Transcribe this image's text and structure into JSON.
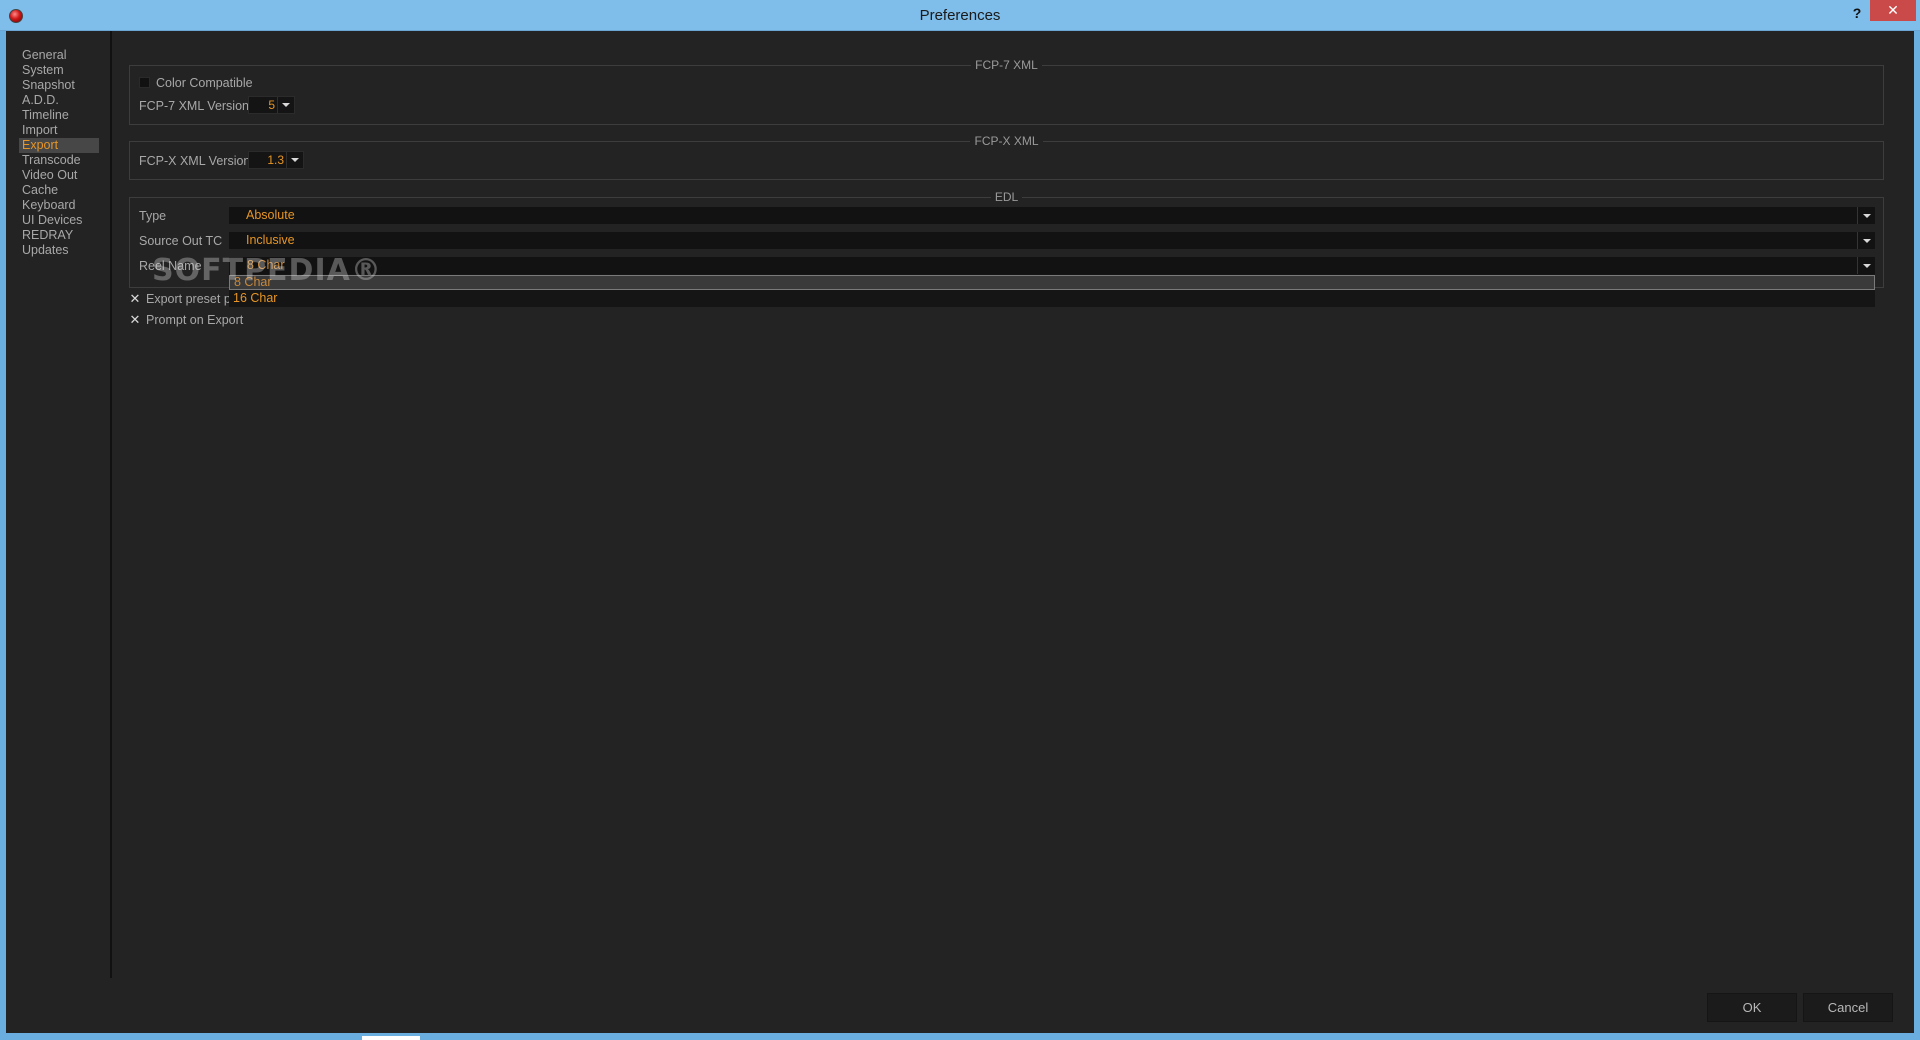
{
  "window": {
    "title": "Preferences",
    "help": "?",
    "close": "✕"
  },
  "sidebar": {
    "items": [
      {
        "label": "General"
      },
      {
        "label": "System"
      },
      {
        "label": "Snapshot"
      },
      {
        "label": "A.D.D."
      },
      {
        "label": "Timeline"
      },
      {
        "label": "Import"
      },
      {
        "label": "Export",
        "active": true
      },
      {
        "label": "Transcode"
      },
      {
        "label": "Video Out"
      },
      {
        "label": "Cache"
      },
      {
        "label": "Keyboard"
      },
      {
        "label": "UI Devices"
      },
      {
        "label": "REDRAY"
      },
      {
        "label": "Updates"
      }
    ]
  },
  "fcp7": {
    "title": "FCP-7 XML",
    "color_compatible_label": "Color Compatible",
    "color_compatible_checked": false,
    "version_label": "FCP-7 XML Version",
    "version_value": "5"
  },
  "fcpx": {
    "title": "FCP-X XML",
    "version_label": "FCP-X XML Version",
    "version_value": "1.3"
  },
  "edl": {
    "title": "EDL",
    "type_label": "Type",
    "type_value": "Absolute",
    "source_out_label": "Source Out TC",
    "source_out_value": "Inclusive",
    "reel_name_label": "Reel Name",
    "reel_name_value": "8 Char",
    "reel_name_options": [
      "8 Char",
      "16 Char"
    ]
  },
  "options": {
    "export_preset_label": "Export preset p",
    "export_preset_checked": true,
    "prompt_on_export_label": "Prompt on Export",
    "prompt_on_export_checked": true
  },
  "watermark": "SOFTPEDIA®",
  "buttons": {
    "ok": "OK",
    "cancel": "Cancel"
  },
  "colors": {
    "accent": "#e69526",
    "background": "#232323",
    "titlebar": "#7fbdea"
  }
}
